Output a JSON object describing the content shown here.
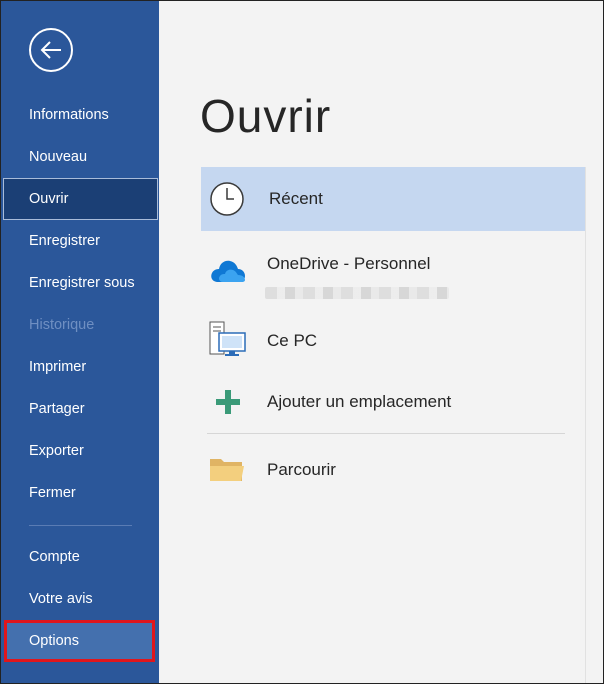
{
  "sidebar": {
    "items": [
      {
        "label": "Informations"
      },
      {
        "label": "Nouveau"
      },
      {
        "label": "Ouvrir"
      },
      {
        "label": "Enregistrer"
      },
      {
        "label": "Enregistrer sous"
      },
      {
        "label": "Historique"
      },
      {
        "label": "Imprimer"
      },
      {
        "label": "Partager"
      },
      {
        "label": "Exporter"
      },
      {
        "label": "Fermer"
      }
    ],
    "footer_items": [
      {
        "label": "Compte"
      },
      {
        "label": "Votre avis"
      },
      {
        "label": "Options"
      }
    ],
    "colors": {
      "background": "#2b579a",
      "selected": "#1b3f75",
      "highlight_border": "#e0161c"
    }
  },
  "main": {
    "title": "Ouvrir",
    "locations": [
      {
        "label": "Récent",
        "icon": "clock-icon"
      },
      {
        "label": "OneDrive - Personnel",
        "icon": "onedrive-cloud-icon"
      },
      {
        "label": "Ce PC",
        "icon": "computer-icon"
      },
      {
        "label": "Ajouter un emplacement",
        "icon": "plus-icon"
      },
      {
        "label": "Parcourir",
        "icon": "folder-icon"
      }
    ],
    "colors": {
      "selected": "#c5d7f0"
    }
  }
}
